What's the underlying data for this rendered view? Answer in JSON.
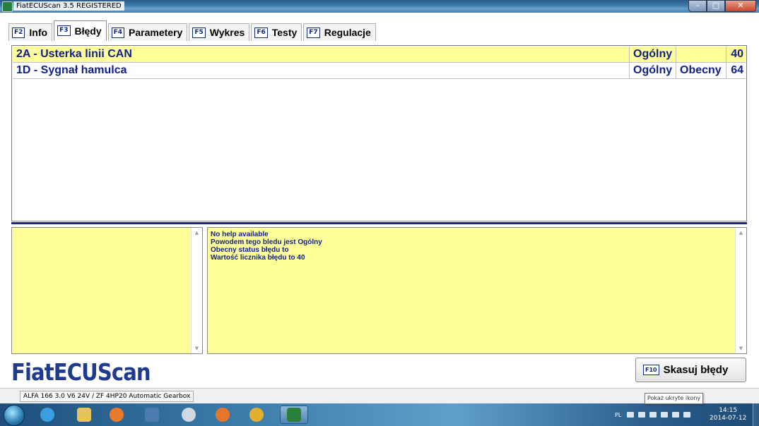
{
  "window": {
    "title": "FiatECUScan 3.5 REGISTERED",
    "controls": {
      "minimize": "–",
      "maximize": "□",
      "close": "✕"
    }
  },
  "tabs": [
    {
      "key": "F2",
      "label": "Info",
      "active": false
    },
    {
      "key": "F3",
      "label": "Błędy",
      "active": true
    },
    {
      "key": "F4",
      "label": "Parametery",
      "active": false
    },
    {
      "key": "F5",
      "label": "Wykres",
      "active": false
    },
    {
      "key": "F6",
      "label": "Testy",
      "active": false
    },
    {
      "key": "F7",
      "label": "Regulacje",
      "active": false
    }
  ],
  "faults": [
    {
      "description": "2A - Usterka linii CAN",
      "type": "Ogólny",
      "status": "",
      "count": "40",
      "selected": true
    },
    {
      "description": "1D - Sygnał hamulca",
      "type": "Ogólny",
      "status": "Obecny",
      "count": "64",
      "selected": false
    }
  ],
  "help": {
    "lines": [
      "No help available",
      "Powodem tego bledu jest Ogólny",
      "Obecny status błędu to",
      "Wartość licznika błędu to 40"
    ]
  },
  "logo": "FiatECUScan",
  "clear_button": {
    "key": "F10",
    "label": "Skasuj błędy"
  },
  "status_bar": {
    "vehicle": "ALFA 166 3.0 V6 24V / ZF 4HP20 Automatic Gearbox"
  },
  "tooltip": "Pokaż ukryte ikony",
  "taskbar": {
    "language": "PL",
    "time": "14:15",
    "date": "2014-07-12",
    "apps": [
      "internet-explorer-icon",
      "file-explorer-icon",
      "media-player-icon",
      "control-icon",
      "safari-icon",
      "firefox-icon",
      "chrome-icon",
      "fiatecuscan-icon"
    ]
  },
  "colors": {
    "fault_text": "#0e1f8a",
    "selected_row": "#ffff99",
    "help_bg": "#ffff99",
    "logo": "#1f3a8f"
  }
}
